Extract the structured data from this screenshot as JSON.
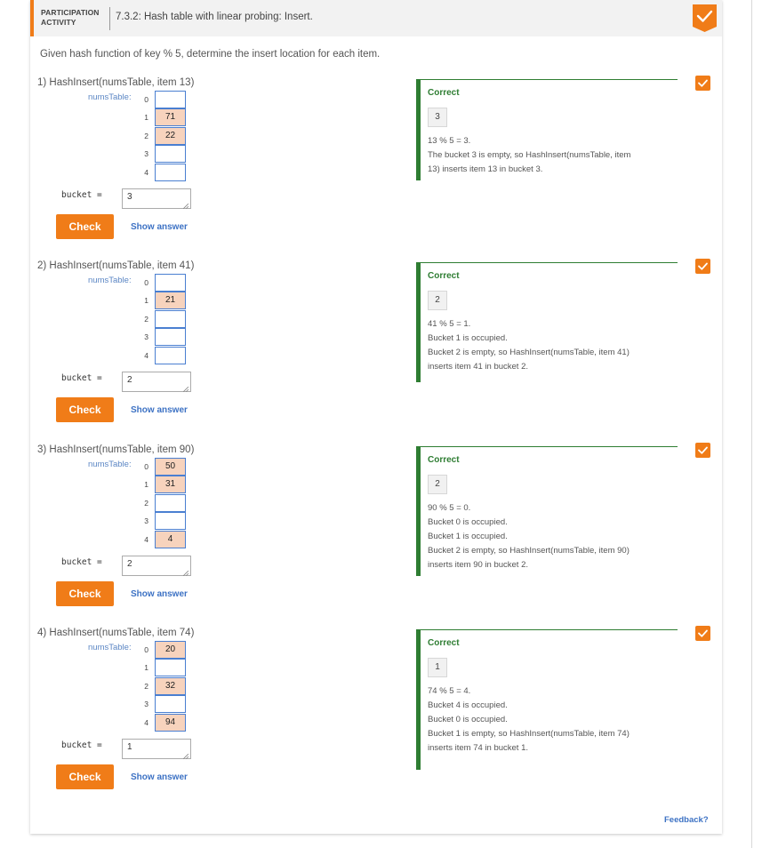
{
  "header": {
    "label_line1": "PARTICIPATION",
    "label_line2": "ACTIVITY",
    "title": "7.3.2: Hash table with linear probing: Insert."
  },
  "intro": "Given hash function of key % 5, determine the insert location for each item.",
  "table_label": "numsTable:",
  "bucket_label": "bucket =",
  "check_label": "Check",
  "show_answer_label": "Show answer",
  "feedback_link": "Feedback?",
  "icons": {
    "complete": "checkmark-icon",
    "question_complete": "checkmark-icon",
    "resize_grip": "resize-grip-icon"
  },
  "colors": {
    "accent": "#f07c18",
    "correct": "#2e7d32",
    "filled_slot": "#f7d3bd",
    "slot_border": "#4a7fd1",
    "link": "#3d72c4"
  },
  "questions": [
    {
      "title": "1) HashInsert(numsTable, item 13)",
      "slots": [
        "",
        "71",
        "22",
        "",
        ""
      ],
      "indices": [
        "0",
        "1",
        "2",
        "3",
        "4"
      ],
      "bucket_value": "3",
      "feedback": {
        "status": "Correct",
        "answer": "3",
        "lines": [
          "13 % 5 = 3.",
          "The bucket 3 is empty, so HashInsert(numsTable, item",
          "13) inserts item 13 in bucket 3."
        ]
      }
    },
    {
      "title": "2) HashInsert(numsTable, item 41)",
      "slots": [
        "",
        "21",
        "",
        "",
        ""
      ],
      "indices": [
        "0",
        "1",
        "2",
        "3",
        "4"
      ],
      "bucket_value": "2",
      "feedback": {
        "status": "Correct",
        "answer": "2",
        "lines": [
          "41 % 5 = 1.",
          "Bucket 1 is occupied.",
          "Bucket 2 is empty, so HashInsert(numsTable, item 41)",
          "inserts item 41 in bucket 2."
        ]
      }
    },
    {
      "title": "3) HashInsert(numsTable, item 90)",
      "slots": [
        "50",
        "31",
        "",
        "",
        "4"
      ],
      "indices": [
        "0",
        "1",
        "2",
        "3",
        "4"
      ],
      "bucket_value": "2",
      "feedback": {
        "status": "Correct",
        "answer": "2",
        "lines": [
          "90 % 5 = 0.",
          "Bucket 0 is occupied.",
          "Bucket 1 is occupied.",
          "Bucket 2 is empty, so HashInsert(numsTable, item 90)",
          "inserts item 90 in bucket 2."
        ]
      }
    },
    {
      "title": "4) HashInsert(numsTable, item 74)",
      "slots": [
        "20",
        "",
        "32",
        "",
        "94"
      ],
      "indices": [
        "0",
        "1",
        "2",
        "3",
        "4"
      ],
      "bucket_value": "1",
      "feedback": {
        "status": "Correct",
        "answer": "1",
        "lines": [
          "74 % 5 = 4.",
          "Bucket 4 is occupied.",
          "Bucket 0 is occupied.",
          "Bucket 1 is empty, so HashInsert(numsTable, item 74)",
          "inserts item 74 in bucket 1."
        ]
      }
    }
  ]
}
